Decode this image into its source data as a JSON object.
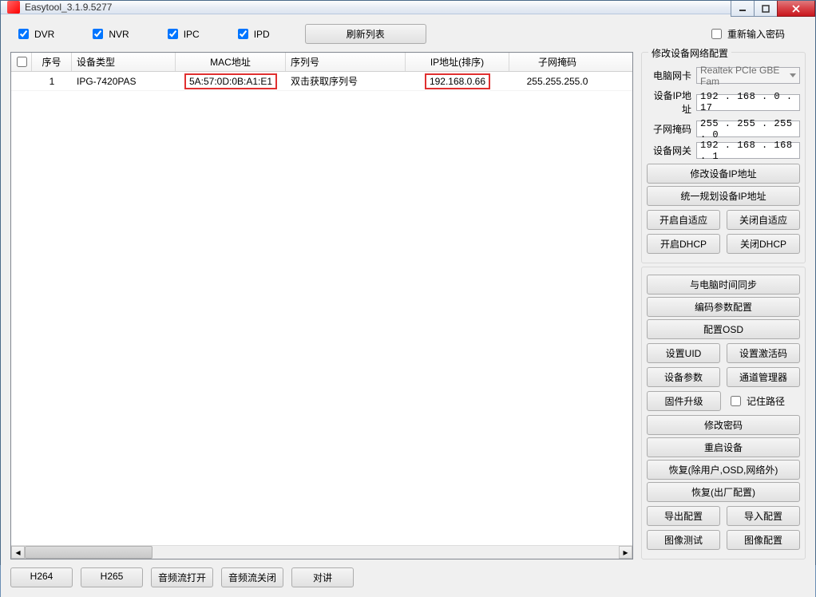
{
  "window": {
    "title": "Easytool_3.1.9.5277"
  },
  "filters": {
    "dvr": "DVR",
    "nvr": "NVR",
    "ipc": "IPC",
    "ipd": "IPD",
    "refresh": "刷新列表",
    "reenter_pwd": "重新输入密码"
  },
  "table": {
    "headers": {
      "no": "序号",
      "type": "设备类型",
      "mac": "MAC地址",
      "serial": "序列号",
      "ip": "IP地址(排序)",
      "mask": "子网掩码"
    },
    "rows": [
      {
        "no": "1",
        "type": "IPG-7420PAS",
        "mac": "5A:57:0D:0B:A1:E1",
        "serial": "双击获取序列号",
        "ip": "192.168.0.66",
        "mask": "255.255.255.0"
      }
    ]
  },
  "side": {
    "group_title": "修改设备网络配置",
    "nic_label": "电脑网卡",
    "nic_value": "Realtek PCIe GBE Fam",
    "ip_label": "设备IP地址",
    "ip_value": "192 . 168 .  0  .  17",
    "mask_label": "子网掩码",
    "mask_value": "255 . 255 . 255 .  0",
    "gw_label": "设备网关",
    "gw_value": "192 . 168 . 168 .  1",
    "btn_modify_ip": "修改设备IP地址",
    "btn_plan_ip": "统一规划设备IP地址",
    "btn_auto_on": "开启自适应",
    "btn_auto_off": "关闭自适应",
    "btn_dhcp_on": "开启DHCP",
    "btn_dhcp_off": "关闭DHCP",
    "btn_time_sync": "与电脑时间同步",
    "btn_enc_param": "编码参数配置",
    "btn_osd": "配置OSD",
    "btn_set_uid": "设置UID",
    "btn_set_act": "设置激活码",
    "btn_dev_param": "设备参数",
    "btn_chan_mgr": "通道管理器",
    "btn_fw_upgrade": "固件升级",
    "chk_remember_path": "记住路径",
    "btn_modify_pwd": "修改密码",
    "btn_reboot": "重启设备",
    "btn_restore_keep": "恢复(除用户,OSD,网络外)",
    "btn_restore_factory": "恢复(出厂配置)",
    "btn_export_cfg": "导出配置",
    "btn_import_cfg": "导入配置",
    "btn_img_test": "图像测试",
    "btn_img_cfg": "图像配置"
  },
  "bottom": {
    "h264": "H264",
    "h265": "H265",
    "audio_on": "音频流打开",
    "audio_off": "音频流关闭",
    "talk": "对讲"
  }
}
